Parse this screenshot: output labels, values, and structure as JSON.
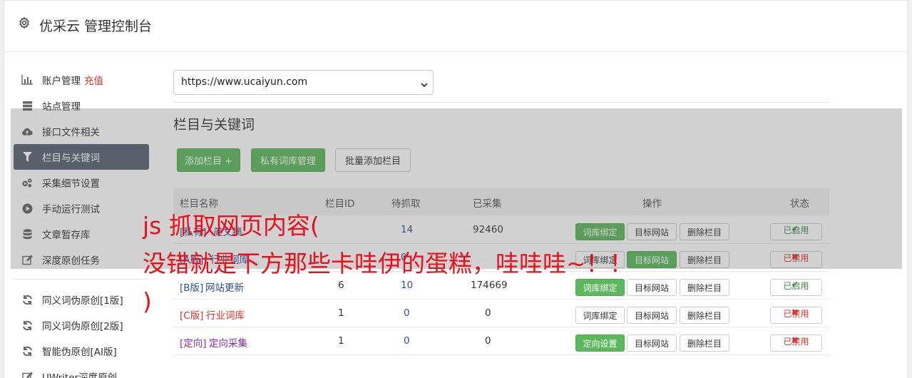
{
  "header": {
    "title": "优采云 管理控制台"
  },
  "sidebar": {
    "items": [
      {
        "label": "账户管理",
        "extra": "充值",
        "icon": "bar-chart-icon"
      },
      {
        "label": "站点管理",
        "icon": "server-icon"
      },
      {
        "label": "接口文件相关",
        "icon": "cloud-upload-icon"
      },
      {
        "label": "栏目与关键词",
        "icon": "filter-icon",
        "active": true
      },
      {
        "label": "采集细节设置",
        "icon": "gears-icon"
      },
      {
        "label": "手动运行测试",
        "icon": "play-circle-icon"
      },
      {
        "label": "文章暂存库",
        "icon": "database-icon"
      },
      {
        "label": "深度原创任务",
        "icon": "edit-icon"
      }
    ],
    "items2": [
      {
        "label": "同义词伪原创[1版]",
        "icon": "refresh-icon"
      },
      {
        "label": "同义词伪原创[2版]",
        "icon": "refresh-icon"
      },
      {
        "label": "智能伪原创[AI版]",
        "icon": "refresh-icon"
      },
      {
        "label": "UWriter深度原创",
        "icon": "edit-icon"
      }
    ]
  },
  "site_select": {
    "value": "https://www.ucaiyun.com"
  },
  "section_title": "栏目与关键词",
  "toolbar": {
    "add_column": "添加栏目 +",
    "private_lib": "私有词库管理",
    "batch_add": "批量添加栏目"
  },
  "table": {
    "headers": [
      "栏目名称",
      "栏目ID",
      "待抓取",
      "已采集",
      "操作",
      "状态"
    ],
    "rows": [
      {
        "tag": "[私有]",
        "name": "美文摘",
        "id": "",
        "pending": "14",
        "collected": "92460",
        "op1": "词库绑定",
        "op2": "目标网站",
        "op3": "删除栏目",
        "status": "已启用",
        "enabled": true
      },
      {
        "tag": "[A版]",
        "name": "行业词库",
        "id": "",
        "pending": "0",
        "collected": "",
        "op1": "词库绑定",
        "op2": "目标网站",
        "op3": "删除栏目",
        "status": "已禁用",
        "enabled": false
      },
      {
        "tag": "[B版]",
        "name": "网站更新",
        "id": "6",
        "pending": "10",
        "collected": "174669",
        "op1": "词库绑定",
        "op2": "目标网站",
        "op3": "删除栏目",
        "status": "已启用",
        "enabled": true
      },
      {
        "tag": "[C版]",
        "name": "行业词库",
        "id": "1",
        "pending": "0",
        "collected": "0",
        "op1": "词库绑定",
        "op2": "目标网站",
        "op3": "删除栏目",
        "status": "已禁用",
        "enabled": false
      },
      {
        "tag": "[定向]",
        "name": "定向采集",
        "id": "1",
        "pending": "0",
        "collected": "0",
        "op1": "定向设置",
        "op2": "目标网站",
        "op3": "删除栏目",
        "status": "已禁用",
        "enabled": false
      }
    ]
  },
  "overlay": {
    "line1": "js 抓取网页内容(",
    "line2": "没错就是下方那些卡哇伊的蛋糕，哇哇哇~！！",
    "line3": ")"
  },
  "colors": {
    "accent_green": "#5cb85c",
    "active_nav": "#5a6372",
    "danger": "#d9322b",
    "overlay_text": "#e8101a"
  }
}
